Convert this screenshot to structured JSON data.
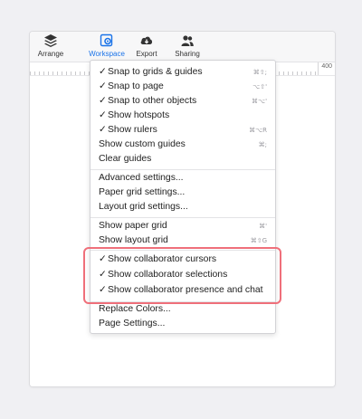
{
  "toolbar": {
    "items": [
      {
        "label": "Arrange",
        "icon": "layers-icon"
      },
      {
        "label": "Workspace",
        "icon": "workspace-gear-icon",
        "active": true
      },
      {
        "label": "Export",
        "icon": "cloud-download-icon"
      },
      {
        "label": "Sharing",
        "icon": "users-icon"
      }
    ]
  },
  "ruler": {
    "mark": "400"
  },
  "menu": {
    "items": [
      {
        "label": "Snap to grids & guides",
        "checked": true,
        "shortcut": "⌘⇧;"
      },
      {
        "label": "Snap to page",
        "checked": true,
        "shortcut": "⌥⇧'"
      },
      {
        "label": "Snap to other objects",
        "checked": true,
        "shortcut": "⌘⌥'"
      },
      {
        "label": "Show hotspots",
        "checked": true,
        "shortcut": ""
      },
      {
        "label": "Show rulers",
        "checked": true,
        "shortcut": "⌘⌥R"
      },
      {
        "label": "Show custom guides",
        "checked": false,
        "shortcut": "⌘;"
      },
      {
        "label": "Clear guides",
        "checked": false,
        "shortcut": ""
      },
      {
        "label": "Advanced settings...",
        "checked": false,
        "shortcut": ""
      },
      {
        "label": "Paper grid settings...",
        "checked": false,
        "shortcut": ""
      },
      {
        "label": "Layout grid settings...",
        "checked": false,
        "shortcut": ""
      },
      {
        "label": "Show paper grid",
        "checked": false,
        "shortcut": "⌘'"
      },
      {
        "label": "Show layout grid",
        "checked": false,
        "shortcut": "⌘⇧G"
      },
      {
        "label": "Show collaborator cursors",
        "checked": true,
        "shortcut": ""
      },
      {
        "label": "Show collaborator selections",
        "checked": true,
        "shortcut": ""
      },
      {
        "label": "Show collaborator presence and chat",
        "checked": true,
        "shortcut": ""
      },
      {
        "label": "Replace Colors...",
        "checked": false,
        "shortcut": ""
      },
      {
        "label": "Page Settings...",
        "checked": false,
        "shortcut": ""
      }
    ],
    "check_glyph": "✓"
  },
  "colors": {
    "accent": "#1a73e8",
    "highlight": "#ef6f7a"
  }
}
